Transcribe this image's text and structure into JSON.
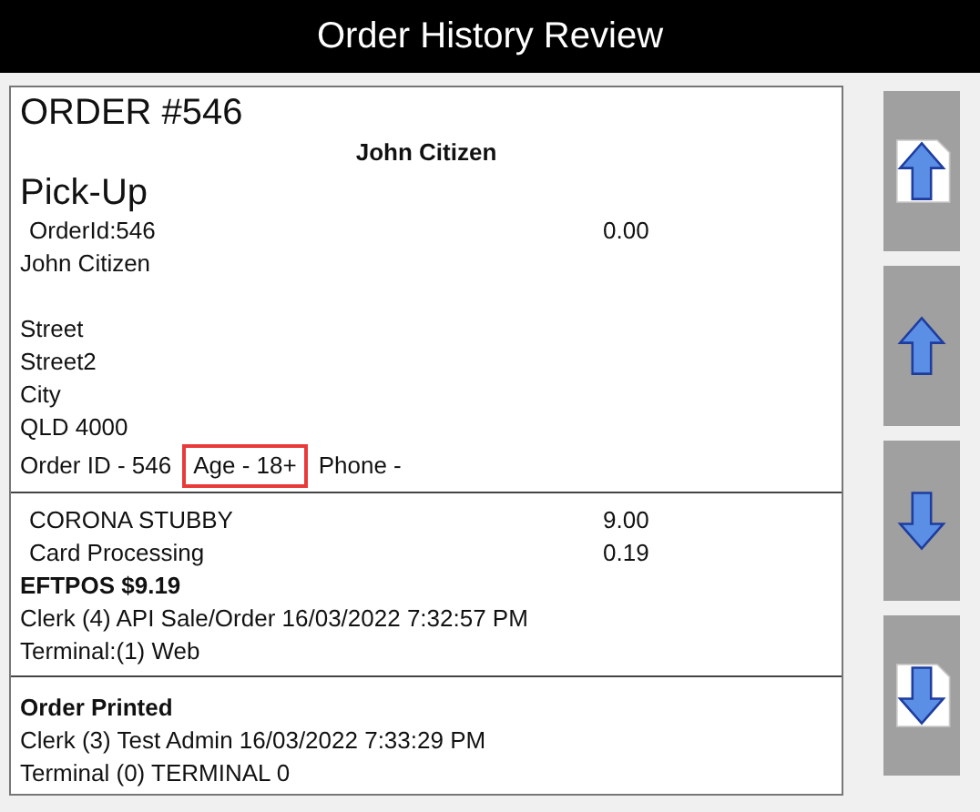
{
  "window": {
    "title": "Order History Review"
  },
  "order": {
    "number": "ORDER #546",
    "customer_heading": "John Citizen",
    "order_type": "Pick-Up",
    "order_id_line": {
      "label": "OrderId:546",
      "amount": "0.00"
    },
    "customer_name": "John Citizen",
    "address": [
      "Street",
      "Street2",
      "City",
      "QLD 4000"
    ],
    "info": [
      {
        "text": "Order ID - 546",
        "highlighted": false
      },
      {
        "text": "Age - 18+",
        "highlighted": true
      },
      {
        "text": "Phone -",
        "highlighted": false
      }
    ]
  },
  "sale": {
    "items": [
      {
        "name": "CORONA STUBBY",
        "price": "9.00"
      },
      {
        "name": "Card Processing",
        "price": "0.19"
      }
    ],
    "payment": "EFTPOS $9.19",
    "clerk": "Clerk (4) API Sale/Order 16/03/2022 7:32:57 PM",
    "terminal": "Terminal:(1) Web"
  },
  "print_log": {
    "heading": "Order Printed",
    "clerk": "Clerk (3) Test Admin 16/03/2022 7:33:29 PM",
    "terminal": "Terminal (0) TERMINAL 0"
  },
  "buttons": [
    {
      "kind": "page_up"
    },
    {
      "kind": "up"
    },
    {
      "kind": "down"
    },
    {
      "kind": "page_down"
    }
  ]
}
